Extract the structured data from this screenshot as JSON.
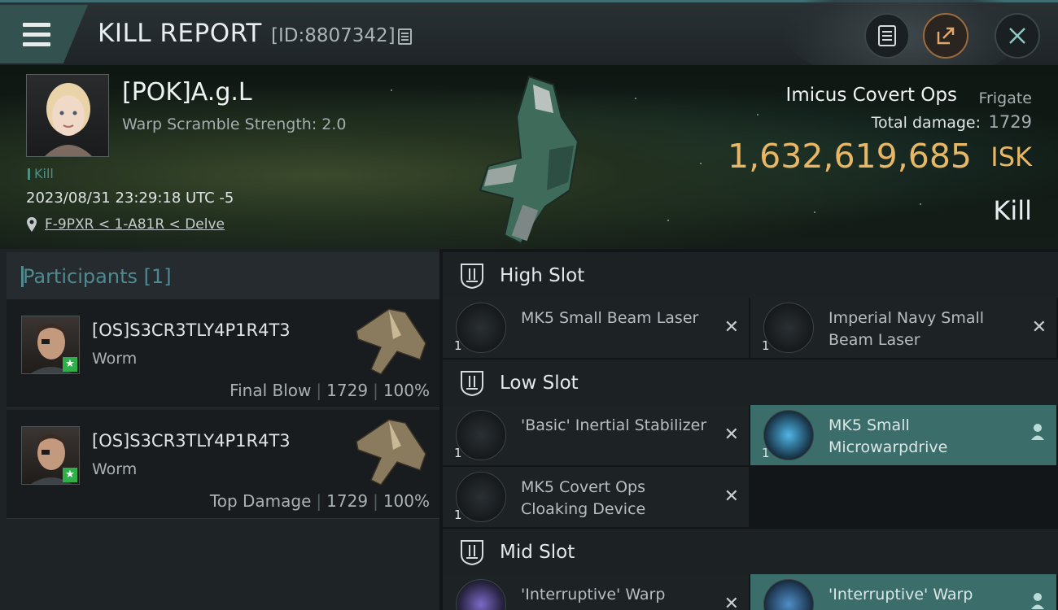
{
  "header": {
    "title": "KILL REPORT",
    "report_id": "[ID:8807342]"
  },
  "victim": {
    "pilot_name": "[POK]A.g.L",
    "warp_scramble": "Warp Scramble Strength: 2.0",
    "kill_tag": "Kill",
    "datetime": "2023/08/31 23:29:18 UTC -5",
    "location": "F-9PXR < 1-A81R < Delve",
    "ship_name": "Imicus Covert Ops",
    "ship_class": "Frigate",
    "total_damage_label": "Total damage:",
    "total_damage": "1729",
    "isk_value": "1,632,619,685",
    "isk_unit": "ISK",
    "outcome": "Kill"
  },
  "participants": {
    "title": "Participants",
    "count": "[1]",
    "rows": [
      {
        "name": "[OS]S3CR3TLY4P1R4T3",
        "ship": "Worm",
        "role": "Final Blow",
        "damage": "1729",
        "percent": "100%"
      },
      {
        "name": "[OS]S3CR3TLY4P1R4T3",
        "ship": "Worm",
        "role": "Top Damage",
        "damage": "1729",
        "percent": "100%"
      }
    ]
  },
  "fitting": {
    "high": {
      "label": "High Slot",
      "modules": [
        {
          "name": "MK5 Small Beam Laser",
          "qty": "1"
        },
        {
          "name": "Imperial Navy Small Beam Laser",
          "qty": "1"
        }
      ]
    },
    "low": {
      "label": "Low Slot",
      "modules": [
        {
          "name": "'Basic' Inertial Stabilizer",
          "qty": "1"
        },
        {
          "name": "MK5 Small Microwarpdrive",
          "qty": "1"
        },
        {
          "name": "MK5 Covert Ops Cloaking Device",
          "qty": "1"
        }
      ]
    },
    "mid": {
      "label": "Mid Slot",
      "modules": [
        {
          "name": "'Interruptive' Warp",
          "qty": "1"
        },
        {
          "name": "'Interruptive' Warp",
          "qty": "1"
        }
      ]
    }
  },
  "colors": {
    "accent_teal": "#4f8a90",
    "isk_gold": "#e8b765",
    "highlight": "#3b6d6b"
  },
  "icons": [
    "menu-icon",
    "copy-icon",
    "clipboard-icon",
    "share-icon",
    "close-icon",
    "location-pin-icon",
    "slot-icon",
    "remove-icon",
    "person-icon"
  ]
}
